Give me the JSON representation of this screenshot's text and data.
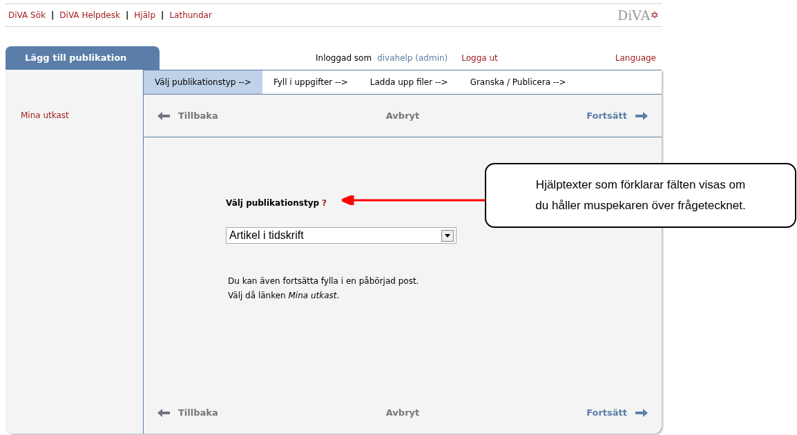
{
  "top_links": [
    "DiVA Sök",
    "DiVA Helpdesk",
    "Hjälp",
    "Lathundar"
  ],
  "top_link_separators": [
    "|",
    "|",
    "|"
  ],
  "logo": {
    "text": "DiVA",
    "star": "✡"
  },
  "main_tab": {
    "label": "Lägg till publikation"
  },
  "user_bar": {
    "prefix": "Inloggad som",
    "user": "divahelp (admin)",
    "logout": "Logga ut",
    "language": "Language"
  },
  "steps": [
    {
      "label": "Välj publikationstyp -->",
      "selected": true
    },
    {
      "label": "Fyll i uppgifter -->",
      "selected": false
    },
    {
      "label": "Ladda upp filer -->",
      "selected": false
    },
    {
      "label": "Granska / Publicera -->",
      "selected": false
    }
  ],
  "sidebar": {
    "items": [
      "Mina utkast"
    ]
  },
  "nav_top": {
    "back": "Tillbaka",
    "cancel": "Avbryt",
    "next": "Fortsätt"
  },
  "form": {
    "label": "Välj publikationstyp",
    "help": "?",
    "select_value": "Artikel i tidskrift",
    "notes": [
      "Du kan även fortsätta fylla i en påbörjad post.",
      "Välj då länken *Mina utkast*."
    ]
  },
  "nav_bottom": {
    "back": "Tillbaka",
    "cancel": "Avbryt",
    "next": "Fortsätt"
  },
  "callout": {
    "lines": [
      "Hjälptexter som förklarar fälten visas om",
      "du håller muspekaren över frågetecknet."
    ]
  }
}
